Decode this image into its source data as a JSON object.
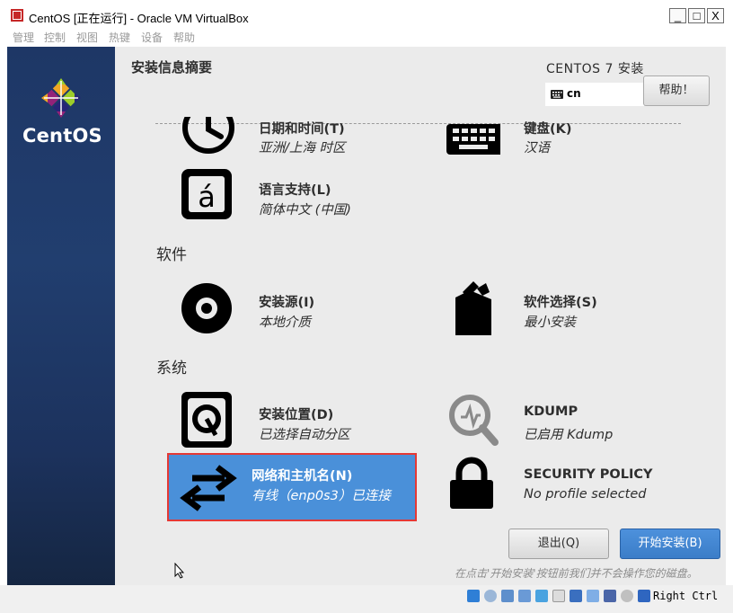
{
  "window": {
    "title": "CentOS [正在运行] - Oracle VM VirtualBox",
    "minimize": "_",
    "maximize": "□",
    "close": "X"
  },
  "menubar": [
    "管理",
    "控制",
    "视图",
    "热键",
    "设备",
    "帮助"
  ],
  "sidebar": {
    "brand": "CentOS"
  },
  "header": {
    "title": "安装信息摘要",
    "product": "CENTOS 7 安装",
    "keyboard_layout": "cn",
    "help_label": "帮助！"
  },
  "sections": {
    "software": "软件",
    "system": "系统"
  },
  "spokes": {
    "datetime": {
      "title": "日期和时间(T)",
      "status": "亚洲/上海 时区"
    },
    "keyboard": {
      "title": "键盘(K)",
      "status": "汉语"
    },
    "language": {
      "title": "语言支持(L)",
      "status": "简体中文 (中国)"
    },
    "source": {
      "title": "安装源(I)",
      "status": "本地介质"
    },
    "software": {
      "title": "软件选择(S)",
      "status": "最小安装"
    },
    "destination": {
      "title": "安装位置(D)",
      "status": "已选择自动分区"
    },
    "kdump": {
      "title": "KDUMP",
      "status": "已启用 Kdump"
    },
    "network": {
      "title": "网络和主机名(N)",
      "status": "有线（enp0s3）已连接"
    },
    "security": {
      "title": "SECURITY POLICY",
      "status": "No profile selected"
    }
  },
  "buttons": {
    "quit": "退出(Q)",
    "begin": "开始安装(B)"
  },
  "footer_note": "在点击'开始安装'按钮前我们并不会操作您的磁盘。",
  "statusbar": {
    "host_key": "Right Ctrl"
  },
  "colors": {
    "sidebar": "#213e6f",
    "selected": "#4a90d9",
    "highlight_box": "#e53935",
    "accent_button": "#3b7dc8"
  }
}
